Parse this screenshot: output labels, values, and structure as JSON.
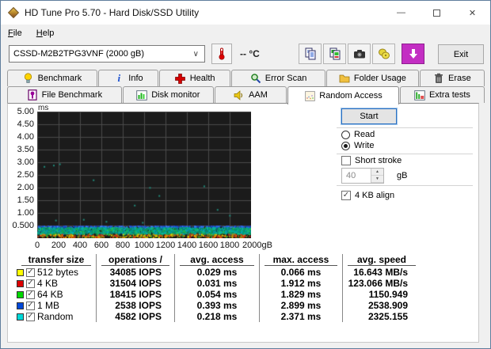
{
  "window": {
    "title": "HD Tune Pro 5.70 - Hard Disk/SSD Utility",
    "controls": {
      "minimize": "—",
      "maximize": "",
      "close": "✕"
    }
  },
  "menu": {
    "items": [
      {
        "label": "File"
      },
      {
        "label": "Help"
      }
    ]
  },
  "toolbar": {
    "drive": "CSSD-M2B2TPG3VNF (2000 gB)",
    "temperature": "-- °C",
    "exit_label": "Exit",
    "buttons": [
      "copy-text",
      "copy-image",
      "screenshot",
      "save",
      "download"
    ]
  },
  "tabs": {
    "row1": [
      {
        "label": "Benchmark",
        "icon": "bulb-icon"
      },
      {
        "label": "Info",
        "icon": "info-icon"
      },
      {
        "label": "Health",
        "icon": "health-icon"
      },
      {
        "label": "Error Scan",
        "icon": "magnifier-icon"
      },
      {
        "label": "Folder Usage",
        "icon": "folder-icon"
      },
      {
        "label": "Erase",
        "icon": "trash-icon"
      }
    ],
    "row2": [
      {
        "label": "File Benchmark",
        "icon": "file-benchmark-icon"
      },
      {
        "label": "Disk monitor",
        "icon": "disk-monitor-icon"
      },
      {
        "label": "AAM",
        "icon": "speaker-icon"
      },
      {
        "label": "Random Access",
        "icon": "scatter-icon",
        "selected": true
      },
      {
        "label": "Extra tests",
        "icon": "extra-tests-icon"
      }
    ],
    "selected": "Random Access"
  },
  "controls": {
    "start_label": "Start",
    "read_label": "Read",
    "write_label": "Write",
    "selected_mode": "Write",
    "short_stroke_label": "Short stroke",
    "short_stroke_checked": false,
    "stroke_value": "40",
    "stroke_unit": "gB",
    "align_label": "4 KB align",
    "align_checked": true,
    "check_glyph": "✓"
  },
  "chart_data": {
    "type": "scatter",
    "title": "Random access time vs disk position (write)",
    "ylabel": "ms",
    "xlabel_unit": "gB",
    "ylim": [
      0,
      5
    ],
    "xlim": [
      0,
      2000
    ],
    "grid": true,
    "background": "#1b1b1b",
    "grid_color": "#4a4a4a",
    "y_ticks": [
      "5.00",
      "4.50",
      "4.00",
      "3.50",
      "3.00",
      "2.50",
      "2.00",
      "1.50",
      "1.00",
      "0.500"
    ],
    "x_ticks": [
      "0",
      "200",
      "400",
      "600",
      "800",
      "1000",
      "1200",
      "1400",
      "1600",
      "1800",
      "2000gB"
    ],
    "bands": [
      {
        "name": "blue-top",
        "count": 520,
        "y_range": [
          0.44,
          0.5
        ],
        "colors": [
          "#1f4fd8",
          "#2e6cf0",
          "#1536a8",
          "#3b82ff"
        ]
      },
      {
        "name": "main-dense",
        "count": 2600,
        "y_range": [
          0.18,
          0.44
        ],
        "colors": [
          "#00b4b4",
          "#00a078",
          "#16a34a",
          "#0891b2",
          "#22c55e",
          "#067c86",
          "#00aaaa",
          "#0d8f5f"
        ]
      },
      {
        "name": "hot-bottom",
        "count": 480,
        "y_range": [
          0.04,
          0.18
        ],
        "colors": [
          "#d8d800",
          "#e08800",
          "#d84010",
          "#30a030",
          "#c8281e",
          "#e0b000"
        ]
      }
    ],
    "outlier_color": "#1f8a7a",
    "outliers": [
      [
        60,
        2.85
      ],
      [
        148,
        2.9
      ],
      [
        205,
        2.95
      ],
      [
        520,
        2.32
      ],
      [
        640,
        0.68
      ],
      [
        168,
        0.73
      ],
      [
        1048,
        2.02
      ],
      [
        1135,
        1.7
      ],
      [
        905,
        1.32
      ],
      [
        1555,
        2.08
      ],
      [
        1795,
        0.92
      ],
      [
        428,
        0.76
      ],
      [
        980,
        0.64
      ],
      [
        1680,
        1.15
      ]
    ]
  },
  "table": {
    "headers": [
      "transfer size",
      "operations /",
      "avg. access",
      "max. access",
      "avg. speed"
    ],
    "rows": [
      {
        "color": "#ffff00",
        "label": "512 bytes",
        "checked": true,
        "ops": "34085 IOPS",
        "avg": "0.029 ms",
        "max": "0.066 ms",
        "speed": "16.643 MB/s"
      },
      {
        "color": "#dd0000",
        "label": "4 KB",
        "checked": true,
        "ops": "31504 IOPS",
        "avg": "0.031 ms",
        "max": "1.912 ms",
        "speed": "123.066 MB/s"
      },
      {
        "color": "#00d800",
        "label": "64 KB",
        "checked": true,
        "ops": "18415 IOPS",
        "avg": "0.054 ms",
        "max": "1.829 ms",
        "speed": "1150.949"
      },
      {
        "color": "#0048d8",
        "label": "1 MB",
        "checked": true,
        "ops": "2538 IOPS",
        "avg": "0.393 ms",
        "max": "2.899 ms",
        "speed": "2538.909"
      },
      {
        "color": "#00d8d8",
        "label": "Random",
        "checked": true,
        "ops": "4582 IOPS",
        "avg": "0.218 ms",
        "max": "2.371 ms",
        "speed": "2325.155"
      }
    ]
  }
}
